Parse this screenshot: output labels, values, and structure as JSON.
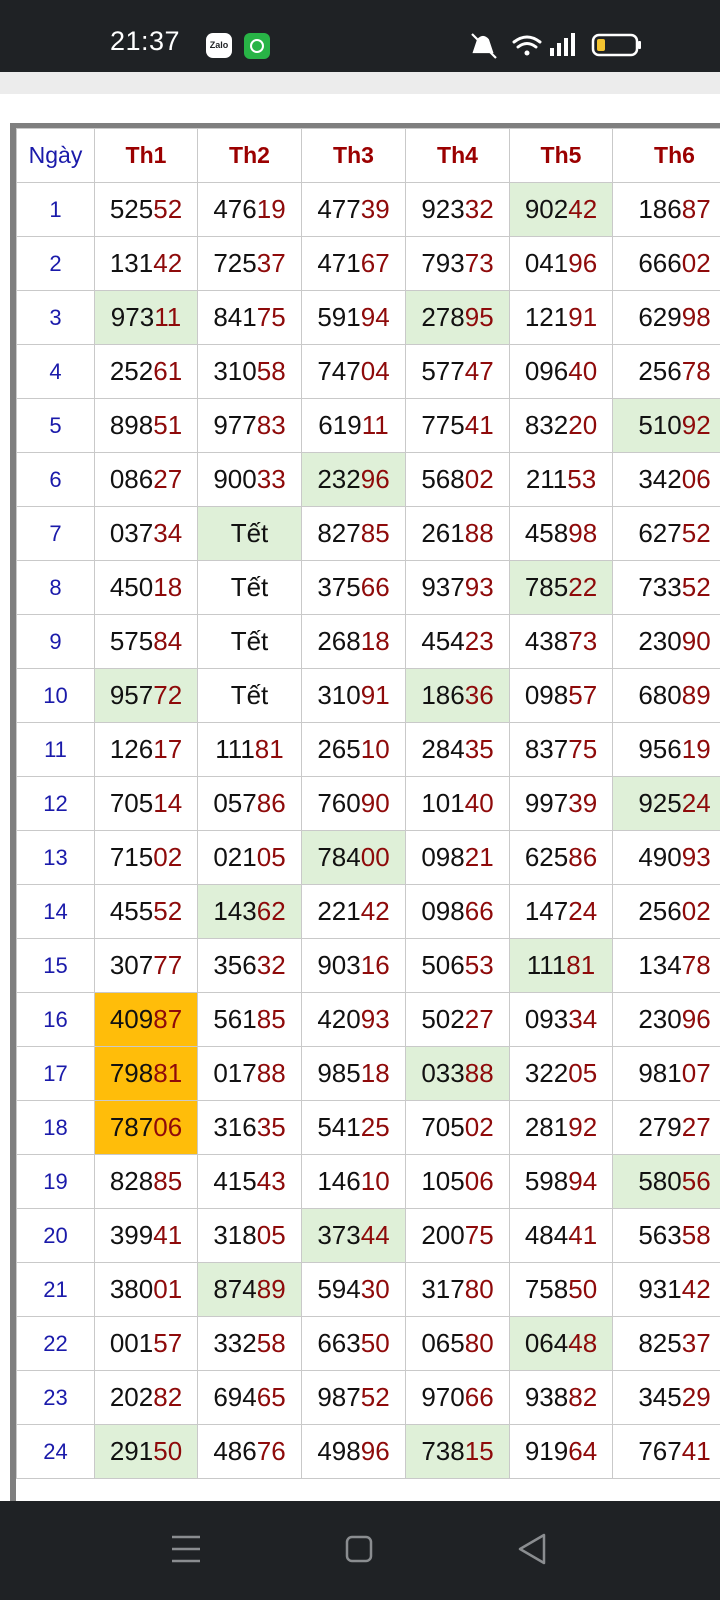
{
  "status_bar": {
    "time": "21:37",
    "zalo_label": "Zalo"
  },
  "table": {
    "headers": [
      "Ngày",
      "Th1",
      "Th2",
      "Th3",
      "Th4",
      "Th5",
      "Th6"
    ],
    "rows": [
      {
        "day": "1",
        "cells": [
          {
            "a": "525",
            "b": "52"
          },
          {
            "a": "476",
            "b": "19"
          },
          {
            "a": "477",
            "b": "39"
          },
          {
            "a": "923",
            "b": "32"
          },
          {
            "a": "902",
            "b": "42",
            "hl": "green"
          },
          {
            "a": "186",
            "b": "87"
          }
        ]
      },
      {
        "day": "2",
        "cells": [
          {
            "a": "131",
            "b": "42"
          },
          {
            "a": "725",
            "b": "37"
          },
          {
            "a": "471",
            "b": "67"
          },
          {
            "a": "793",
            "b": "73"
          },
          {
            "a": "041",
            "b": "96"
          },
          {
            "a": "666",
            "b": "02"
          }
        ]
      },
      {
        "day": "3",
        "cells": [
          {
            "a": "973",
            "b": "11",
            "hl": "green"
          },
          {
            "a": "841",
            "b": "75"
          },
          {
            "a": "591",
            "b": "94"
          },
          {
            "a": "278",
            "b": "95",
            "hl": "green"
          },
          {
            "a": "121",
            "b": "91"
          },
          {
            "a": "629",
            "b": "98"
          }
        ]
      },
      {
        "day": "4",
        "cells": [
          {
            "a": "252",
            "b": "61"
          },
          {
            "a": "310",
            "b": "58"
          },
          {
            "a": "747",
            "b": "04"
          },
          {
            "a": "577",
            "b": "47"
          },
          {
            "a": "096",
            "b": "40"
          },
          {
            "a": "256",
            "b": "78"
          }
        ]
      },
      {
        "day": "5",
        "cells": [
          {
            "a": "898",
            "b": "51"
          },
          {
            "a": "977",
            "b": "83"
          },
          {
            "a": "619",
            "b": "11"
          },
          {
            "a": "775",
            "b": "41"
          },
          {
            "a": "832",
            "b": "20"
          },
          {
            "a": "510",
            "b": "92",
            "hl": "green"
          }
        ]
      },
      {
        "day": "6",
        "cells": [
          {
            "a": "086",
            "b": "27"
          },
          {
            "a": "900",
            "b": "33"
          },
          {
            "a": "232",
            "b": "96",
            "hl": "green"
          },
          {
            "a": "568",
            "b": "02"
          },
          {
            "a": "211",
            "b": "53"
          },
          {
            "a": "342",
            "b": "06"
          }
        ]
      },
      {
        "day": "7",
        "cells": [
          {
            "a": "037",
            "b": "34"
          },
          {
            "text": "Tết",
            "hl": "green"
          },
          {
            "a": "827",
            "b": "85"
          },
          {
            "a": "261",
            "b": "88"
          },
          {
            "a": "458",
            "b": "98"
          },
          {
            "a": "627",
            "b": "52"
          }
        ]
      },
      {
        "day": "8",
        "cells": [
          {
            "a": "450",
            "b": "18"
          },
          {
            "text": "Tết"
          },
          {
            "a": "375",
            "b": "66"
          },
          {
            "a": "937",
            "b": "93"
          },
          {
            "a": "785",
            "b": "22",
            "hl": "green"
          },
          {
            "a": "733",
            "b": "52"
          }
        ]
      },
      {
        "day": "9",
        "cells": [
          {
            "a": "575",
            "b": "84"
          },
          {
            "text": "Tết"
          },
          {
            "a": "268",
            "b": "18"
          },
          {
            "a": "454",
            "b": "23"
          },
          {
            "a": "438",
            "b": "73"
          },
          {
            "a": "230",
            "b": "90"
          }
        ]
      },
      {
        "day": "10",
        "cells": [
          {
            "a": "957",
            "b": "72",
            "hl": "green"
          },
          {
            "text": "Tết"
          },
          {
            "a": "310",
            "b": "91"
          },
          {
            "a": "186",
            "b": "36",
            "hl": "green"
          },
          {
            "a": "098",
            "b": "57"
          },
          {
            "a": "680",
            "b": "89"
          }
        ]
      },
      {
        "day": "11",
        "cells": [
          {
            "a": "126",
            "b": "17"
          },
          {
            "a": "111",
            "b": "81"
          },
          {
            "a": "265",
            "b": "10"
          },
          {
            "a": "284",
            "b": "35"
          },
          {
            "a": "837",
            "b": "75"
          },
          {
            "a": "956",
            "b": "19"
          }
        ]
      },
      {
        "day": "12",
        "cells": [
          {
            "a": "705",
            "b": "14"
          },
          {
            "a": "057",
            "b": "86"
          },
          {
            "a": "760",
            "b": "90"
          },
          {
            "a": "101",
            "b": "40"
          },
          {
            "a": "997",
            "b": "39"
          },
          {
            "a": "925",
            "b": "24",
            "hl": "green"
          }
        ]
      },
      {
        "day": "13",
        "cells": [
          {
            "a": "715",
            "b": "02"
          },
          {
            "a": "021",
            "b": "05"
          },
          {
            "a": "784",
            "b": "00",
            "hl": "green"
          },
          {
            "a": "098",
            "b": "21"
          },
          {
            "a": "625",
            "b": "86"
          },
          {
            "a": "490",
            "b": "93"
          }
        ]
      },
      {
        "day": "14",
        "cells": [
          {
            "a": "455",
            "b": "52"
          },
          {
            "a": "143",
            "b": "62",
            "hl": "green"
          },
          {
            "a": "221",
            "b": "42"
          },
          {
            "a": "098",
            "b": "66"
          },
          {
            "a": "147",
            "b": "24"
          },
          {
            "a": "256",
            "b": "02"
          }
        ]
      },
      {
        "day": "15",
        "cells": [
          {
            "a": "307",
            "b": "77"
          },
          {
            "a": "356",
            "b": "32"
          },
          {
            "a": "903",
            "b": "16"
          },
          {
            "a": "506",
            "b": "53"
          },
          {
            "a": "111",
            "b": "81",
            "hl": "green"
          },
          {
            "a": "134",
            "b": "78"
          }
        ]
      },
      {
        "day": "16",
        "cells": [
          {
            "a": "409",
            "b": "87",
            "hl": "orange"
          },
          {
            "a": "561",
            "b": "85"
          },
          {
            "a": "420",
            "b": "93"
          },
          {
            "a": "502",
            "b": "27"
          },
          {
            "a": "093",
            "b": "34"
          },
          {
            "a": "230",
            "b": "96"
          }
        ]
      },
      {
        "day": "17",
        "cells": [
          {
            "a": "798",
            "b": "81",
            "hl": "orange"
          },
          {
            "a": "017",
            "b": "88"
          },
          {
            "a": "985",
            "b": "18"
          },
          {
            "a": "033",
            "b": "88",
            "hl": "green"
          },
          {
            "a": "322",
            "b": "05"
          },
          {
            "a": "981",
            "b": "07"
          }
        ]
      },
      {
        "day": "18",
        "cells": [
          {
            "a": "787",
            "b": "06",
            "hl": "orange"
          },
          {
            "a": "316",
            "b": "35"
          },
          {
            "a": "541",
            "b": "25"
          },
          {
            "a": "705",
            "b": "02"
          },
          {
            "a": "281",
            "b": "92"
          },
          {
            "a": "279",
            "b": "27"
          }
        ]
      },
      {
        "day": "19",
        "cells": [
          {
            "a": "828",
            "b": "85"
          },
          {
            "a": "415",
            "b": "43"
          },
          {
            "a": "146",
            "b": "10"
          },
          {
            "a": "105",
            "b": "06"
          },
          {
            "a": "598",
            "b": "94"
          },
          {
            "a": "580",
            "b": "56",
            "hl": "green"
          }
        ]
      },
      {
        "day": "20",
        "cells": [
          {
            "a": "399",
            "b": "41"
          },
          {
            "a": "318",
            "b": "05"
          },
          {
            "a": "373",
            "b": "44",
            "hl": "green"
          },
          {
            "a": "200",
            "b": "75"
          },
          {
            "a": "484",
            "b": "41"
          },
          {
            "a": "563",
            "b": "58"
          }
        ]
      },
      {
        "day": "21",
        "cells": [
          {
            "a": "380",
            "b": "01"
          },
          {
            "a": "874",
            "b": "89",
            "hl": "green"
          },
          {
            "a": "594",
            "b": "30"
          },
          {
            "a": "317",
            "b": "80"
          },
          {
            "a": "758",
            "b": "50"
          },
          {
            "a": "931",
            "b": "42"
          }
        ]
      },
      {
        "day": "22",
        "cells": [
          {
            "a": "001",
            "b": "57"
          },
          {
            "a": "332",
            "b": "58"
          },
          {
            "a": "663",
            "b": "50"
          },
          {
            "a": "065",
            "b": "80"
          },
          {
            "a": "064",
            "b": "48",
            "hl": "green"
          },
          {
            "a": "825",
            "b": "37"
          }
        ]
      },
      {
        "day": "23",
        "cells": [
          {
            "a": "202",
            "b": "82"
          },
          {
            "a": "694",
            "b": "65"
          },
          {
            "a": "987",
            "b": "52"
          },
          {
            "a": "970",
            "b": "66"
          },
          {
            "a": "938",
            "b": "82"
          },
          {
            "a": "345",
            "b": "29"
          }
        ]
      },
      {
        "day": "24",
        "cells": [
          {
            "a": "291",
            "b": "50",
            "hl": "green"
          },
          {
            "a": "486",
            "b": "76"
          },
          {
            "a": "498",
            "b": "96"
          },
          {
            "a": "738",
            "b": "15",
            "hl": "green"
          },
          {
            "a": "919",
            "b": "64"
          },
          {
            "a": "767",
            "b": "41"
          }
        ]
      }
    ]
  },
  "colors": {
    "green_highlight": "#dff0d8",
    "orange_highlight": "#ffbd0a",
    "header_red": "#9b0000",
    "day_blue": "#1a1aaa",
    "digit_red": "#8e0a0a"
  },
  "nav_bar": {
    "icons": [
      "menu-icon",
      "home-square-icon",
      "back-triangle-icon"
    ]
  }
}
